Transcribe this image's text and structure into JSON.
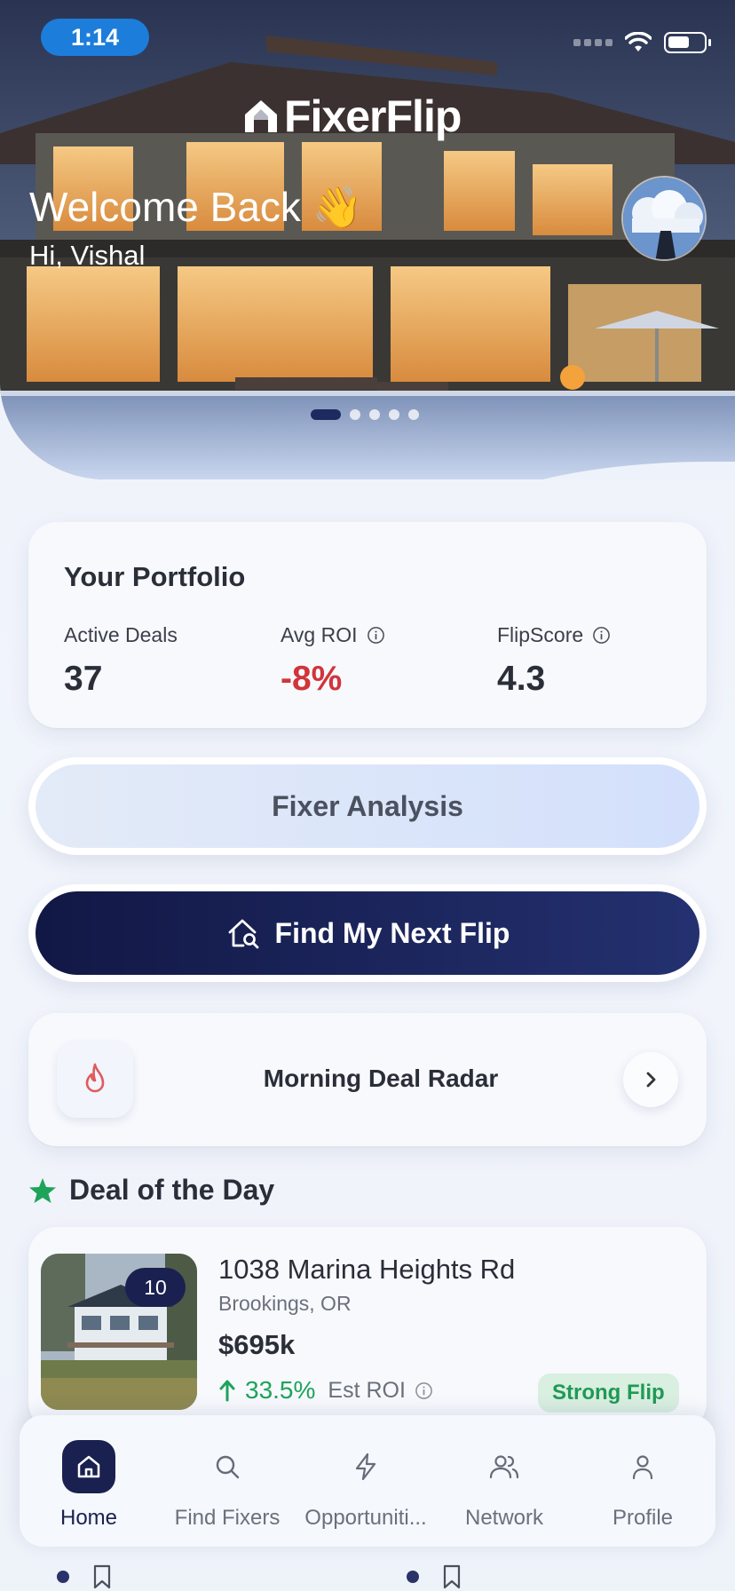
{
  "status_bar": {
    "time": "1:14"
  },
  "hero": {
    "app_name": "FixerFlip",
    "welcome": "Welcome Back 👋",
    "greeting": "Hi, Vishal",
    "carousel_active_index": 0,
    "carousel_count": 5
  },
  "portfolio": {
    "title": "Your Portfolio",
    "stats": [
      {
        "label": "Active Deals",
        "value": "37"
      },
      {
        "label": "Avg ROI",
        "value": "-8%"
      },
      {
        "label": "FlipScore",
        "value": "4.3"
      }
    ]
  },
  "buttons": {
    "analysis": "Fixer Analysis",
    "find_flip": "Find My Next Flip"
  },
  "radar": {
    "title": "Morning Deal Radar"
  },
  "deal_of_day": {
    "title": "Deal of the Day",
    "score": "10",
    "address": "1038 Marina Heights Rd",
    "city": "Brookings, OR",
    "price": "$695k",
    "roi": "33.5%",
    "roi_label": "Est ROI",
    "badge": "Strong Flip"
  },
  "nav": {
    "items": [
      {
        "label": "Home",
        "icon": "home-icon"
      },
      {
        "label": "Find Fixers",
        "icon": "search-icon"
      },
      {
        "label": "Opportuniti...",
        "icon": "bolt-icon"
      },
      {
        "label": "Network",
        "icon": "users-icon"
      },
      {
        "label": "Profile",
        "icon": "user-icon"
      }
    ]
  },
  "colors": {
    "navy": "#1a2150",
    "negative": "#d0353a",
    "positive": "#1ea35a",
    "status_pill": "#1c7ddb"
  }
}
